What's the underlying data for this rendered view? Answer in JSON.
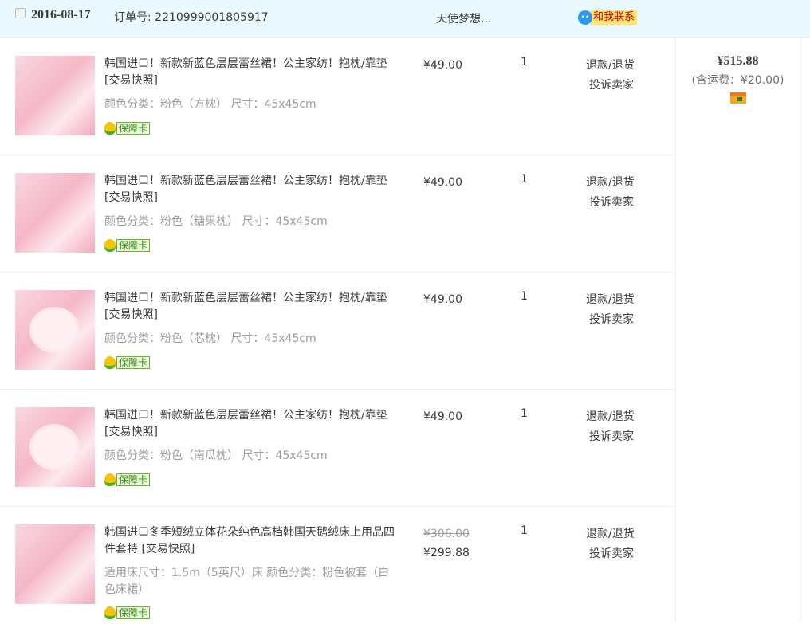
{
  "order": {
    "date": "2016-08-17",
    "order_no": "订单号: 2210999001805917",
    "seller": "天使梦想...",
    "contact_label": "和我联系",
    "total": "¥515.88",
    "shipping": "(含运费：¥20.00)"
  },
  "items": [
    {
      "title": "韩国进口！新款新蓝色层层蕾丝裙！公主家纺！抱枕/靠垫 [交易快照]",
      "sku": "颜色分类：粉色（方枕） 尺寸：45x45cm",
      "price": "¥49.00",
      "qty": "1",
      "badge": "保障卡",
      "refund": "退款/退货",
      "complain": "投诉卖家"
    },
    {
      "title": "韩国进口！新款新蓝色层层蕾丝裙！公主家纺！抱枕/靠垫 [交易快照]",
      "sku": "颜色分类：粉色（糖果枕） 尺寸：45x45cm",
      "price": "¥49.00",
      "qty": "1",
      "badge": "保障卡",
      "refund": "退款/退货",
      "complain": "投诉卖家"
    },
    {
      "title": "韩国进口！新款新蓝色层层蕾丝裙！公主家纺！抱枕/靠垫 [交易快照]",
      "sku": "颜色分类：粉色（芯枕） 尺寸：45x45cm",
      "price": "¥49.00",
      "qty": "1",
      "badge": "保障卡",
      "refund": "退款/退货",
      "complain": "投诉卖家"
    },
    {
      "title": "韩国进口！新款新蓝色层层蕾丝裙！公主家纺！抱枕/靠垫 [交易快照]",
      "sku": "颜色分类：粉色（南瓜枕） 尺寸：45x45cm",
      "price": "¥49.00",
      "qty": "1",
      "badge": "保障卡",
      "refund": "退款/退货",
      "complain": "投诉卖家"
    },
    {
      "title": "韩国进口冬季短绒立体花朵纯色高档韩国天鹅绒床上用品四件套特 [交易快照]",
      "sku": "适用床尺寸：1.5m（5英尺）床  颜色分类：粉色被套（白色床裙）",
      "old_price": "¥306.00",
      "price": "¥299.88",
      "qty": "1",
      "badge": "保障卡",
      "refund": "退款/退货",
      "complain": "投诉卖家"
    }
  ]
}
